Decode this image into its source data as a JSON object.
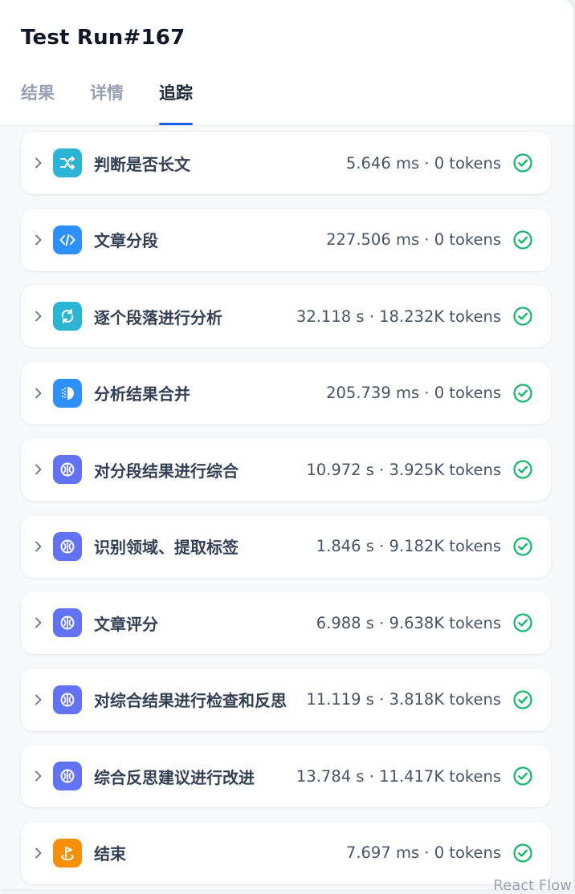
{
  "run": {
    "title": "Test Run#167"
  },
  "tabs": [
    {
      "label": "结果",
      "active": false
    },
    {
      "label": "详情",
      "active": false
    },
    {
      "label": "追踪",
      "active": true
    }
  ],
  "colors": {
    "success": "#12b76a",
    "accent": "#155eef",
    "icon_cyan": "#2bb4d4",
    "icon_blue": "#2e90fa",
    "icon_indigo": "#6172f3",
    "icon_orange": "#f79009"
  },
  "nodes": [
    {
      "name": "判断是否长文",
      "metrics": "5.646 ms · 0 tokens",
      "icon": "if-else-branch-icon",
      "status": "success"
    },
    {
      "name": "文章分段",
      "metrics": "227.506 ms · 0 tokens",
      "icon": "code-icon",
      "status": "success"
    },
    {
      "name": "逐个段落进行分析",
      "metrics": "32.118 s · 18.232K tokens",
      "icon": "iteration-icon",
      "status": "success"
    },
    {
      "name": "分析结果合并",
      "metrics": "205.739 ms · 0 tokens",
      "icon": "aggregator-icon",
      "status": "success"
    },
    {
      "name": "对分段结果进行综合",
      "metrics": "10.972 s · 3.925K tokens",
      "icon": "llm-icon",
      "status": "success"
    },
    {
      "name": "识别领域、提取标签",
      "metrics": "1.846 s · 9.182K tokens",
      "icon": "llm-icon",
      "status": "success"
    },
    {
      "name": "文章评分",
      "metrics": "6.988 s · 9.638K tokens",
      "icon": "llm-icon",
      "status": "success"
    },
    {
      "name": "对综合结果进行检查和反思",
      "metrics": "11.119 s · 3.818K tokens",
      "icon": "llm-icon",
      "status": "success"
    },
    {
      "name": "综合反思建议进行改进",
      "metrics": "13.784 s · 11.417K tokens",
      "icon": "llm-icon",
      "status": "success"
    },
    {
      "name": "结束",
      "metrics": "7.697 ms · 0 tokens",
      "icon": "end-icon",
      "status": "success"
    }
  ],
  "watermark": "React Flow"
}
